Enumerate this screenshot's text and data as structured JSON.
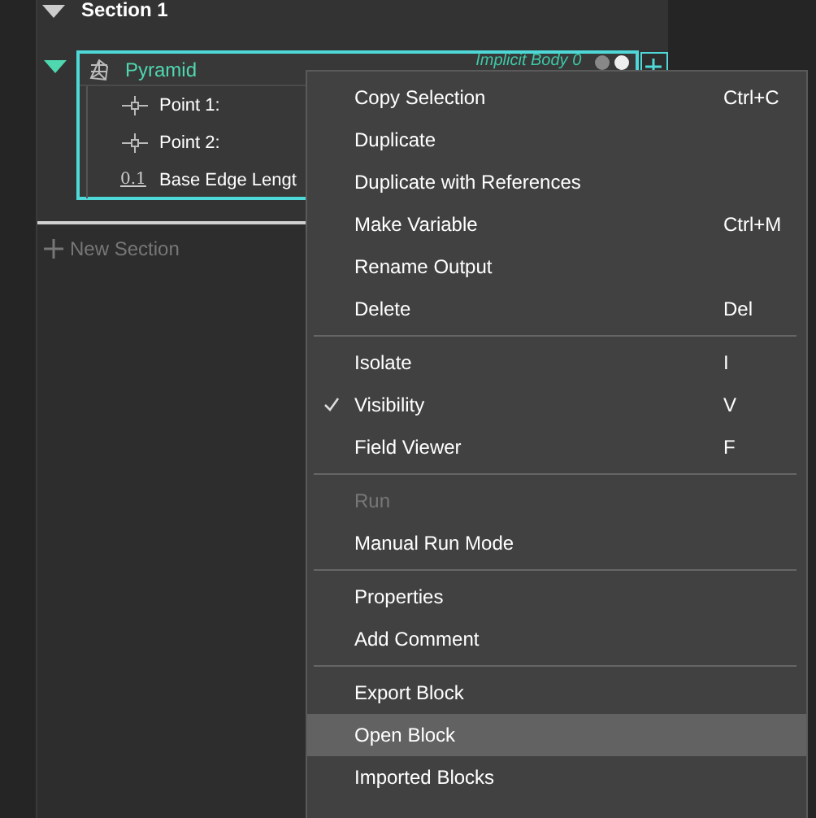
{
  "section": {
    "title": "Section 1",
    "expanded": true
  },
  "block": {
    "title": "Pyramid",
    "subtitle": "Implicit Body 0",
    "expanded": true,
    "selected": true,
    "inputs": [
      {
        "kind": "point",
        "label": "Point 1:"
      },
      {
        "kind": "point",
        "label": "Point 2:"
      },
      {
        "kind": "number",
        "icon_text": "0.1",
        "label": "Base Edge Lengt"
      }
    ]
  },
  "new_section": {
    "label": "New Section"
  },
  "context_menu": [
    {
      "kind": "item",
      "label": "Copy Selection",
      "shortcut": "Ctrl+C",
      "disabled": false,
      "checked": false,
      "selected": false
    },
    {
      "kind": "item",
      "label": "Duplicate",
      "disabled": false,
      "checked": false,
      "selected": false
    },
    {
      "kind": "item",
      "label": "Duplicate with References",
      "disabled": false,
      "checked": false,
      "selected": false
    },
    {
      "kind": "item",
      "label": "Make Variable",
      "shortcut": "Ctrl+M",
      "disabled": false,
      "checked": false,
      "selected": false
    },
    {
      "kind": "item",
      "label": "Rename Output",
      "disabled": false,
      "checked": false,
      "selected": false
    },
    {
      "kind": "item",
      "label": "Delete",
      "shortcut": "Del",
      "disabled": false,
      "checked": false,
      "selected": false
    },
    {
      "kind": "separator"
    },
    {
      "kind": "item",
      "label": "Isolate",
      "shortcut": "I",
      "disabled": false,
      "checked": false,
      "selected": false
    },
    {
      "kind": "item",
      "label": "Visibility",
      "shortcut": "V",
      "disabled": false,
      "checked": true,
      "selected": false
    },
    {
      "kind": "item",
      "label": "Field Viewer",
      "shortcut": "F",
      "disabled": false,
      "checked": false,
      "selected": false
    },
    {
      "kind": "separator"
    },
    {
      "kind": "item",
      "label": "Run",
      "disabled": true,
      "checked": false,
      "selected": false
    },
    {
      "kind": "item",
      "label": "Manual Run Mode",
      "disabled": false,
      "checked": false,
      "selected": false
    },
    {
      "kind": "separator"
    },
    {
      "kind": "item",
      "label": "Properties",
      "disabled": false,
      "checked": false,
      "selected": false
    },
    {
      "kind": "item",
      "label": "Add Comment",
      "disabled": false,
      "checked": false,
      "selected": false
    },
    {
      "kind": "separator"
    },
    {
      "kind": "item",
      "label": "Export Block",
      "disabled": false,
      "checked": false,
      "selected": false
    },
    {
      "kind": "item",
      "label": "Open Block",
      "disabled": false,
      "checked": false,
      "selected": true
    },
    {
      "kind": "item",
      "label": "Imported Blocks",
      "disabled": false,
      "checked": false,
      "selected": false
    }
  ]
}
